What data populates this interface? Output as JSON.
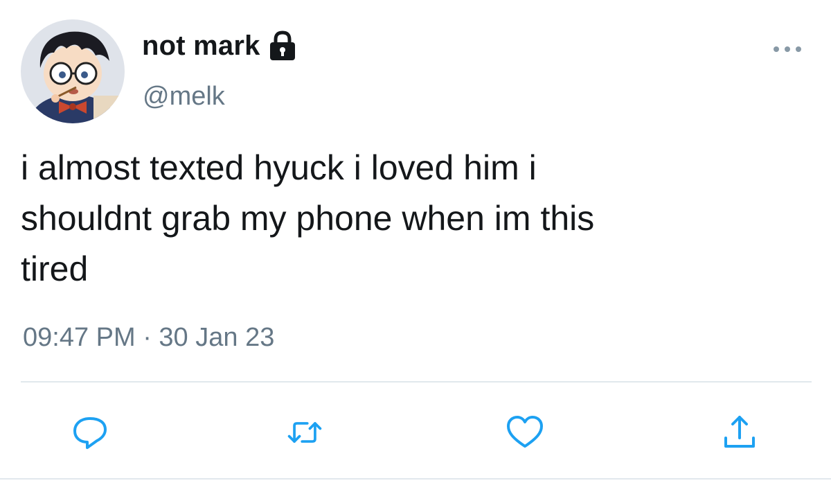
{
  "user": {
    "display_name": "not mark",
    "handle": "@melk",
    "protected": true,
    "avatar": "anime-boy-with-glasses-avatar"
  },
  "tweet": {
    "text_lines": [
      "i almost texted hyuck i loved him i",
      "shouldnt grab my phone when im this",
      "tired"
    ],
    "timestamp": "09:47 PM · 30 Jan 23"
  },
  "actions": {
    "reply": "reply-icon",
    "retweet": "retweet-icon",
    "like": "heart-icon",
    "share": "share-icon"
  },
  "colors": {
    "text": "#14171a",
    "secondary": "#657786",
    "accent": "#1da1f2",
    "divider": "#e1e8ed"
  }
}
